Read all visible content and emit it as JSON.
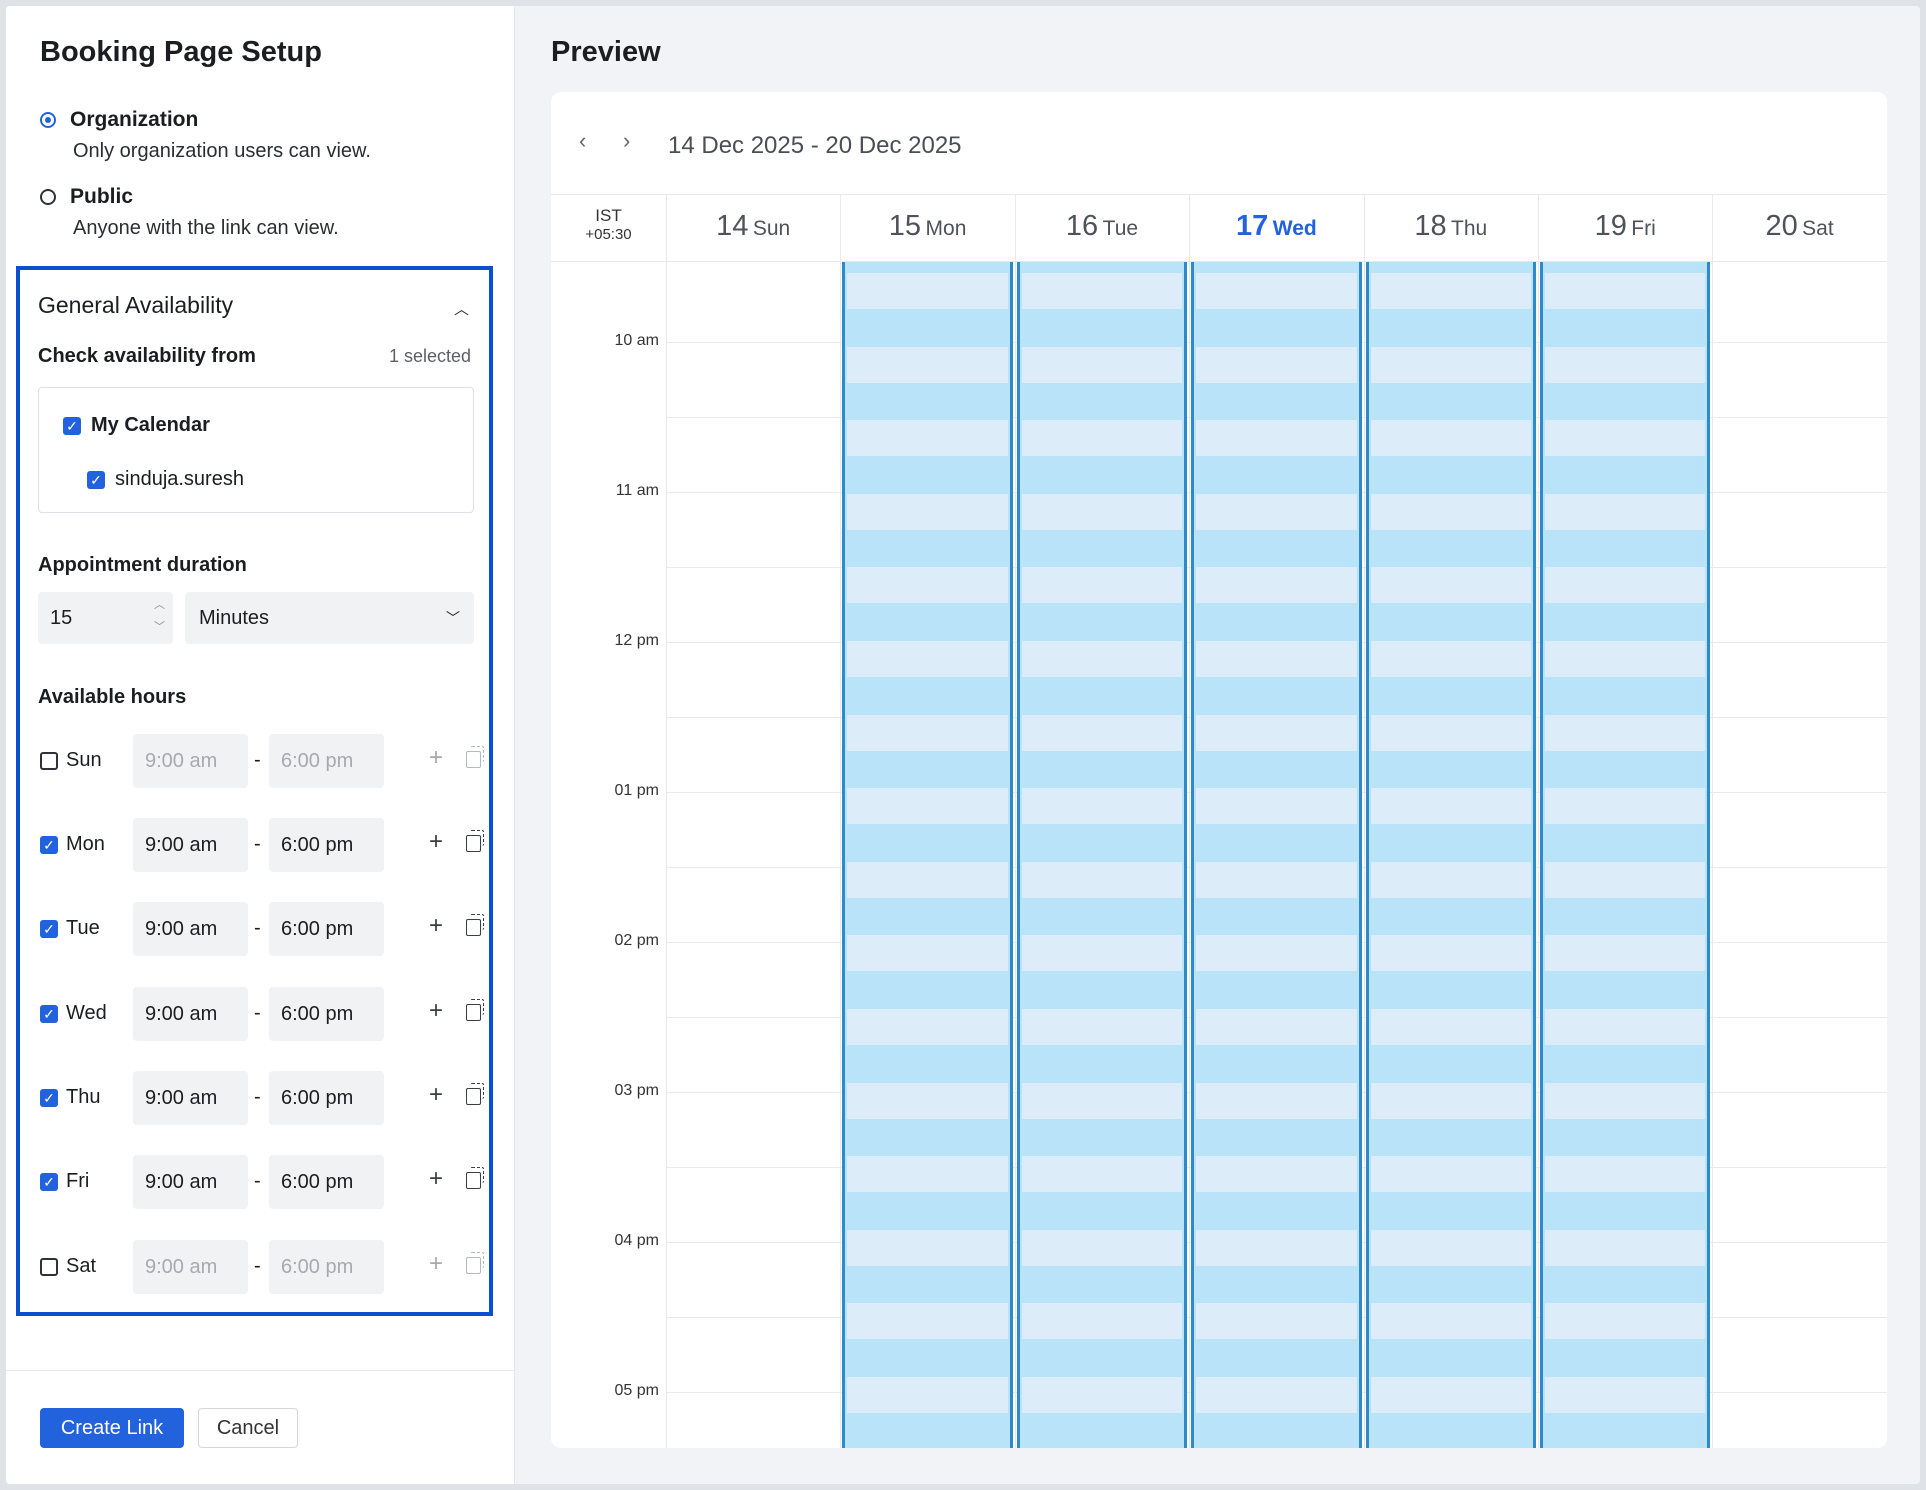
{
  "setup": {
    "title": "Booking Page Setup",
    "visibility": [
      {
        "label": "Organization",
        "desc": "Only organization users can view.",
        "selected": true
      },
      {
        "label": "Public",
        "desc": "Anyone with the link can view.",
        "selected": false
      }
    ]
  },
  "general": {
    "title": "General Availability",
    "check_label": "Check availability from",
    "selected_count": "1 selected",
    "calendar_group": "My Calendar",
    "calendar_account": "sinduja.suresh",
    "duration_label": "Appointment duration",
    "duration_value": "15",
    "duration_unit": "Minutes",
    "hours_label": "Available hours",
    "days": [
      {
        "name": "Sun",
        "checked": false,
        "start": "9:00 am",
        "end": "6:00 pm"
      },
      {
        "name": "Mon",
        "checked": true,
        "start": "9:00 am",
        "end": "6:00 pm"
      },
      {
        "name": "Tue",
        "checked": true,
        "start": "9:00 am",
        "end": "6:00 pm"
      },
      {
        "name": "Wed",
        "checked": true,
        "start": "9:00 am",
        "end": "6:00 pm"
      },
      {
        "name": "Thu",
        "checked": true,
        "start": "9:00 am",
        "end": "6:00 pm"
      },
      {
        "name": "Fri",
        "checked": true,
        "start": "9:00 am",
        "end": "6:00 pm"
      },
      {
        "name": "Sat",
        "checked": false,
        "start": "9:00 am",
        "end": "6:00 pm"
      }
    ],
    "separator": "-"
  },
  "footer": {
    "create": "Create Link",
    "cancel": "Cancel"
  },
  "preview": {
    "title": "Preview",
    "range": "14 Dec 2025 - 20 Dec 2025",
    "tz_name": "IST",
    "tz_offset": "+05:30",
    "columns": [
      {
        "num": "14",
        "day": "Sun",
        "today": false,
        "available": false
      },
      {
        "num": "15",
        "day": "Mon",
        "today": false,
        "available": true
      },
      {
        "num": "16",
        "day": "Tue",
        "today": false,
        "available": true
      },
      {
        "num": "17",
        "day": "Wed",
        "today": true,
        "available": true
      },
      {
        "num": "18",
        "day": "Thu",
        "today": false,
        "available": true
      },
      {
        "num": "19",
        "day": "Fri",
        "today": false,
        "available": true
      },
      {
        "num": "20",
        "day": "Sat",
        "today": false,
        "available": false
      }
    ],
    "times": [
      "10 am",
      "11 am",
      "12 pm",
      "01 pm",
      "02 pm",
      "03 pm",
      "04 pm",
      "05 pm"
    ]
  },
  "colors": {
    "accent": "#2262dc",
    "highlight_border": "#0b4fd1",
    "available": "#b8e3f8",
    "slot": "#dcecf8"
  }
}
